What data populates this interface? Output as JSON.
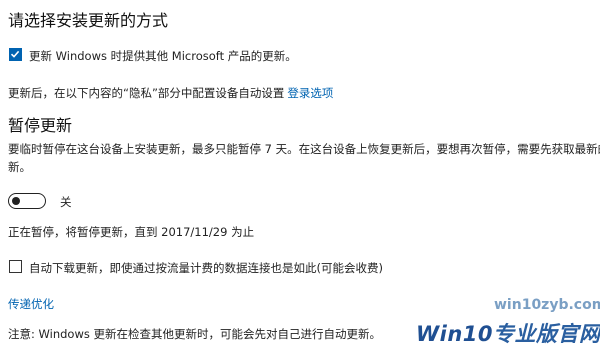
{
  "section_title": "请选择安装更新的方式",
  "checkbox_ms": {
    "label": "更新 Windows 时提供其他 Microsoft 产品的更新。",
    "checked": true
  },
  "privacy_text": "更新后，在以下内容的“隐私”部分中配置设备自动设置",
  "login_link": "登录选项",
  "pause_title": "暂停更新",
  "pause_desc_line1": "要临时暂停在这台设备上安装更新，最多只能暂停 7 天。在这台设备上恢复更新后，要想再次暂停，需要先获取最新的更",
  "pause_desc_line2": "新。",
  "toggle": {
    "state_label": "关",
    "on": false
  },
  "paused_status": "正在暂停，将暂停更新，直到 2017/11/29 为止",
  "checkbox_metered": {
    "label": "自动下载更新，即使通过按流量计费的数据连接也是如此(可能会收费)",
    "checked": false
  },
  "delivery_link": "传递优化",
  "note": "注意: Windows 更新在检查其他更新时，可能会先对自己进行自动更新。",
  "watermark": {
    "url": "win10zyb.com",
    "logo_win10": "Win10",
    "logo_rest": "专业版官网"
  },
  "colors": {
    "accent": "#0063b1"
  }
}
